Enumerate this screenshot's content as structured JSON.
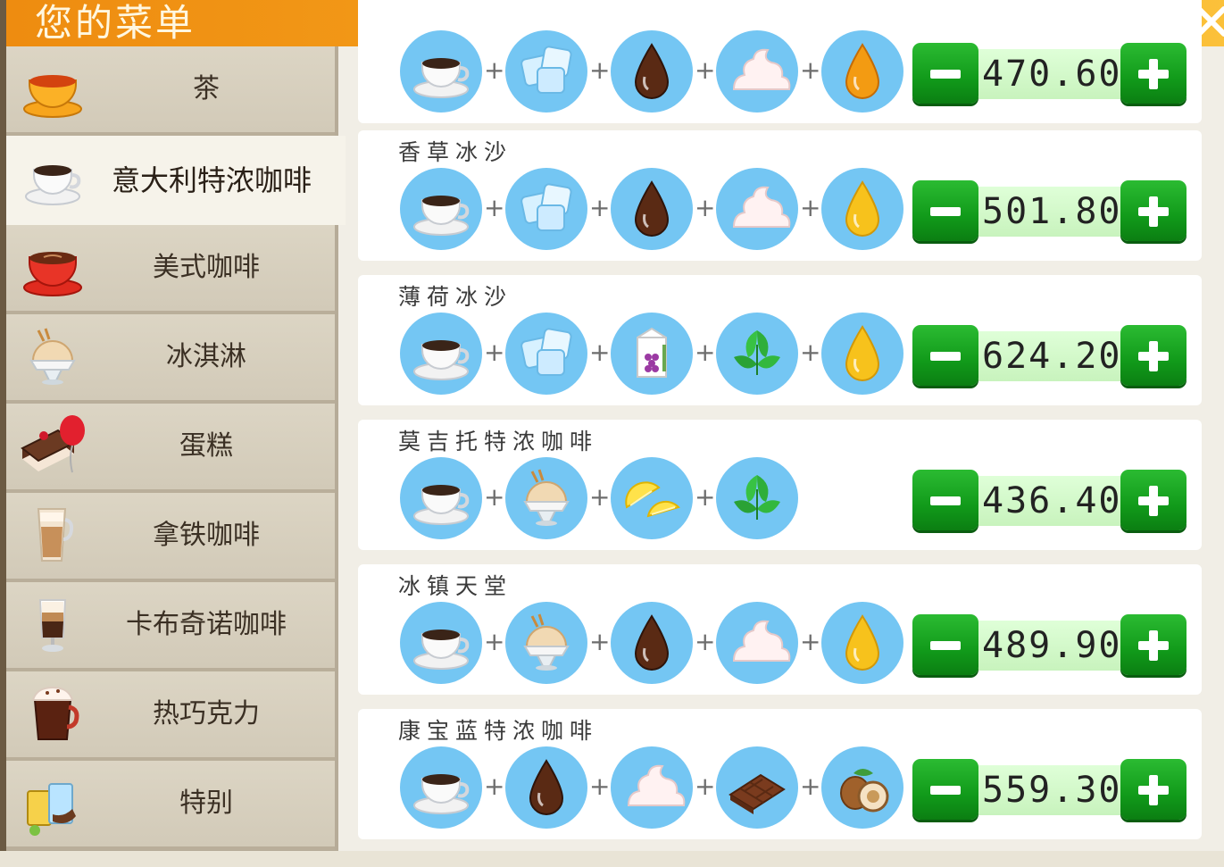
{
  "header": {
    "title": "您的菜单",
    "close_icon": "close-icon"
  },
  "colors": {
    "header_start": "#ee8c10",
    "header_end": "#fbc13a",
    "button_green": "#15a31e",
    "icon_circle": "#74c6f3",
    "price_bg": "#d4f7ca"
  },
  "categories": [
    {
      "label": "茶",
      "icon": "tea-cup-icon"
    },
    {
      "label": "意大利特浓咖啡",
      "icon": "espresso-cup-icon",
      "active": true
    },
    {
      "label": "美式咖啡",
      "icon": "american-coffee-icon"
    },
    {
      "label": "冰淇淋",
      "icon": "ice-cream-icon"
    },
    {
      "label": "蛋糕",
      "icon": "cake-balloon-icon"
    },
    {
      "label": "拿铁咖啡",
      "icon": "latte-glass-icon"
    },
    {
      "label": "卡布奇诺咖啡",
      "icon": "cappuccino-glass-icon"
    },
    {
      "label": "热巧克力",
      "icon": "hot-chocolate-icon"
    },
    {
      "label": "特别",
      "icon": "special-drinks-icon"
    }
  ],
  "recipes": [
    {
      "name": "",
      "price": "470.60",
      "ingredients": [
        "coffee-cup-icon",
        "ice-cubes-icon",
        "chocolate-syrup-drop-icon",
        "whipped-cream-icon",
        "caramel-syrup-drop-icon"
      ]
    },
    {
      "name": "香草冰沙",
      "price": "501.80",
      "ingredients": [
        "coffee-cup-icon",
        "ice-cubes-icon",
        "chocolate-syrup-drop-icon",
        "whipped-cream-icon",
        "vanilla-syrup-drop-icon"
      ]
    },
    {
      "name": "薄荷冰沙",
      "price": "624.20",
      "ingredients": [
        "coffee-cup-icon",
        "ice-cubes-icon",
        "grape-juice-carton-icon",
        "mint-leaves-icon",
        "vanilla-syrup-drop-icon"
      ]
    },
    {
      "name": "莫吉托特浓咖啡",
      "price": "436.40",
      "ingredients": [
        "coffee-cup-icon",
        "ice-cream-icon",
        "lemon-slices-icon",
        "mint-leaves-icon"
      ]
    },
    {
      "name": "冰镇天堂",
      "price": "489.90",
      "ingredients": [
        "coffee-cup-icon",
        "ice-cream-icon",
        "chocolate-syrup-drop-icon",
        "whipped-cream-icon",
        "vanilla-syrup-drop-icon"
      ]
    },
    {
      "name": "康宝蓝特浓咖啡",
      "price": "559.30",
      "ingredients": [
        "coffee-cup-icon",
        "chocolate-syrup-drop-icon",
        "whipped-cream-icon",
        "chocolate-bar-icon",
        "hazelnuts-icon"
      ]
    }
  ],
  "stepper": {
    "minus_icon": "minus-icon",
    "plus_icon": "plus-icon",
    "ingredient_separator": "+"
  }
}
